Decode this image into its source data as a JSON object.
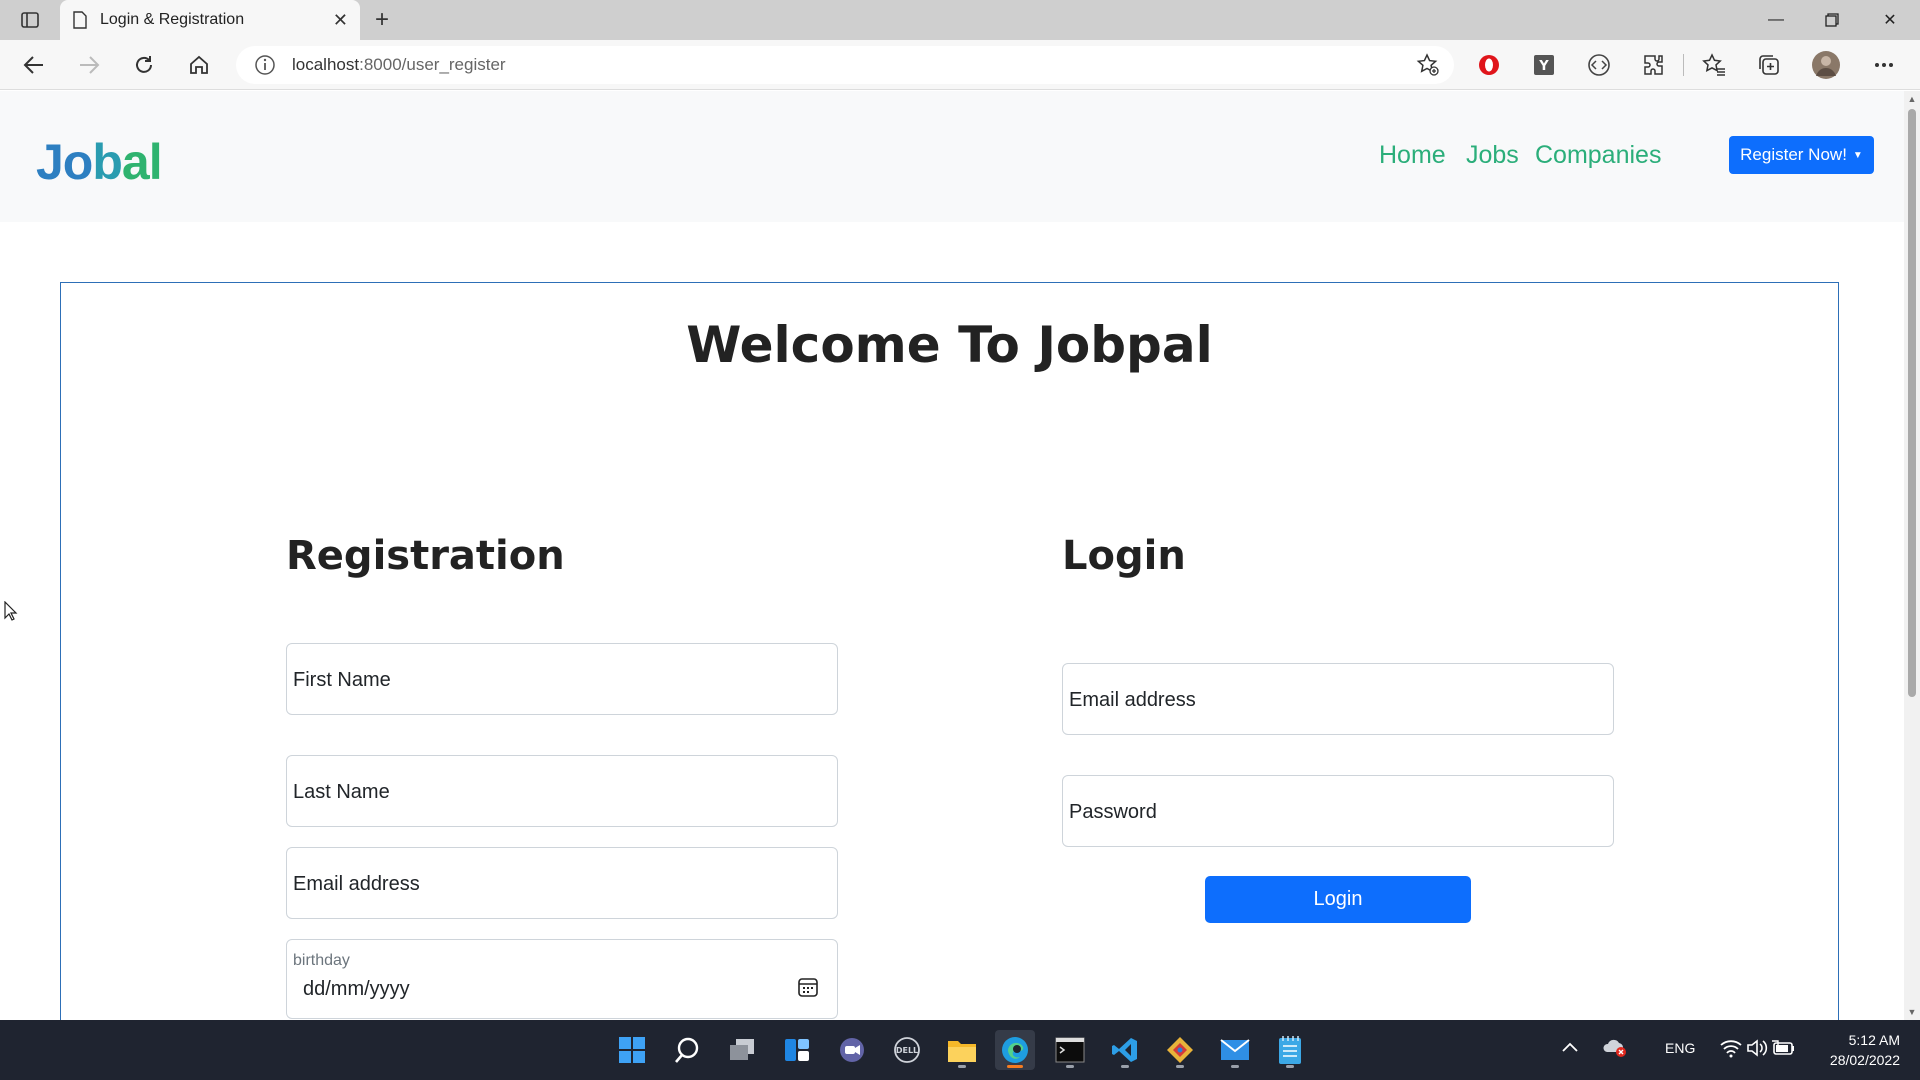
{
  "browser": {
    "tab_title": "Login & Registration",
    "new_tab_label": "+",
    "url_host": "localhost",
    "url_rest": ":8000/user_register",
    "icons": [
      "tab-actions-icon",
      "page-icon",
      "close-icon",
      "back-icon",
      "forward-icon",
      "refresh-icon",
      "home-icon",
      "info-icon",
      "add-favorite-icon",
      "opera-icon",
      "y-extension-icon",
      "code-extension-icon",
      "extensions-icon",
      "favorites-icon",
      "collections-icon",
      "profile-avatar",
      "more-icon"
    ]
  },
  "navbar": {
    "logo": {
      "part1": "Jo",
      "part2": "b",
      "part3": "al"
    },
    "links": [
      "Home",
      "Jobs",
      "Companies"
    ],
    "register_button": "Register Now!"
  },
  "main": {
    "heading": "Welcome To Jobpal",
    "registration": {
      "title": "Registration",
      "first_name": "First Name",
      "last_name": "Last Name",
      "email": "Email address",
      "birthday_label": "birthday",
      "birthday_value": "dd/mm/yyyy"
    },
    "login": {
      "title": "Login",
      "email": "Email address",
      "password": "Password",
      "button": "Login"
    }
  },
  "taskbar": {
    "language": "ENG",
    "time": "5:12 AM",
    "date": "28/02/2022"
  },
  "colors": {
    "primary": "#0d6efd",
    "nav_link": "#2bae7a",
    "panel_border": "#2d6fb7"
  }
}
